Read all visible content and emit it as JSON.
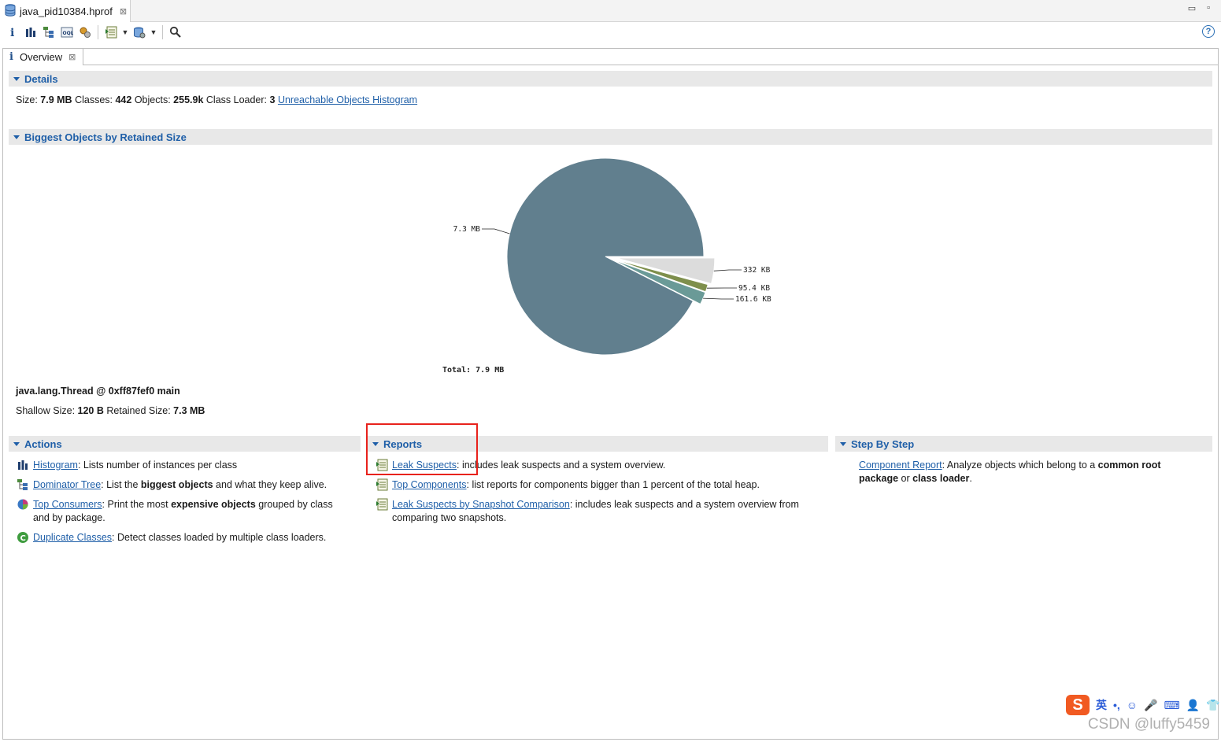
{
  "editor_tab": {
    "title": "java_pid10384.hprof"
  },
  "window_buttons": {
    "minimize": "▭",
    "maximize": "▫"
  },
  "toolbar": {
    "help": "?"
  },
  "view_tab": {
    "title": "Overview"
  },
  "details": {
    "header": "Details",
    "size_label": "Size:",
    "size_value": "7.9 MB",
    "classes_label": "Classes:",
    "classes_value": "442",
    "objects_label": "Objects:",
    "objects_value": "255.9k",
    "loader_label": "Class Loader:",
    "loader_value": "3",
    "histogram_link": "Unreachable Objects Histogram"
  },
  "biggest": {
    "header": "Biggest Objects by Retained Size",
    "total_label": "Total: 7.9 MB",
    "object_title": "java.lang.Thread @ 0xff87fef0 main",
    "shallow_label": "Shallow Size:",
    "shallow_value": "120 B",
    "retained_label": "Retained Size:",
    "retained_value": "7.3 MB"
  },
  "chart_data": {
    "type": "pie",
    "title": "",
    "slices": [
      {
        "label": "7.3 MB",
        "value": 7.3,
        "color": "#617f8e"
      },
      {
        "label": "332 KB",
        "value": 0.332,
        "color": "#dcdcdc"
      },
      {
        "label": "95.4 KB",
        "value": 0.0954,
        "color": "#7e8f4c"
      },
      {
        "label": "161.6 KB",
        "value": 0.1616,
        "color": "#6a9a97"
      }
    ],
    "total": "Total: 7.9 MB"
  },
  "actions": {
    "header": "Actions",
    "items": [
      {
        "link": "Histogram",
        "desc1": ": Lists number of instances per class"
      },
      {
        "link": "Dominator Tree",
        "desc1": ": List the ",
        "bold": "biggest objects",
        "desc2": " and what they keep alive."
      },
      {
        "link": "Top Consumers",
        "desc1": ": Print the most ",
        "bold": "expensive objects",
        "desc2": " grouped by class and by package."
      },
      {
        "link": "Duplicate Classes",
        "desc1": ": Detect classes loaded by multiple class loaders."
      }
    ]
  },
  "reports": {
    "header": "Reports",
    "items": [
      {
        "link": "Leak Suspects",
        "desc": ": includes leak suspects and a system overview."
      },
      {
        "link": "Top Components",
        "desc": ": list reports for components bigger than 1 percent of the total heap."
      },
      {
        "link": "Leak Suspects by Snapshot Comparison",
        "desc": ": includes leak suspects and a system overview from comparing two snapshots."
      }
    ]
  },
  "stepbystep": {
    "header": "Step By Step",
    "link": "Component Report",
    "desc1": ": Analyze objects which belong to a ",
    "bold1": "common root package",
    "desc2": " or ",
    "bold2": "class loader",
    "desc3": "."
  },
  "ime": {
    "logo": "S",
    "lang": "英",
    "punct": "•,",
    "emoji": "☺",
    "mic": "🎤",
    "keyboard": "⌨",
    "user": "👤",
    "shirt": "👕"
  },
  "watermark": "CSDN @luffy5459"
}
